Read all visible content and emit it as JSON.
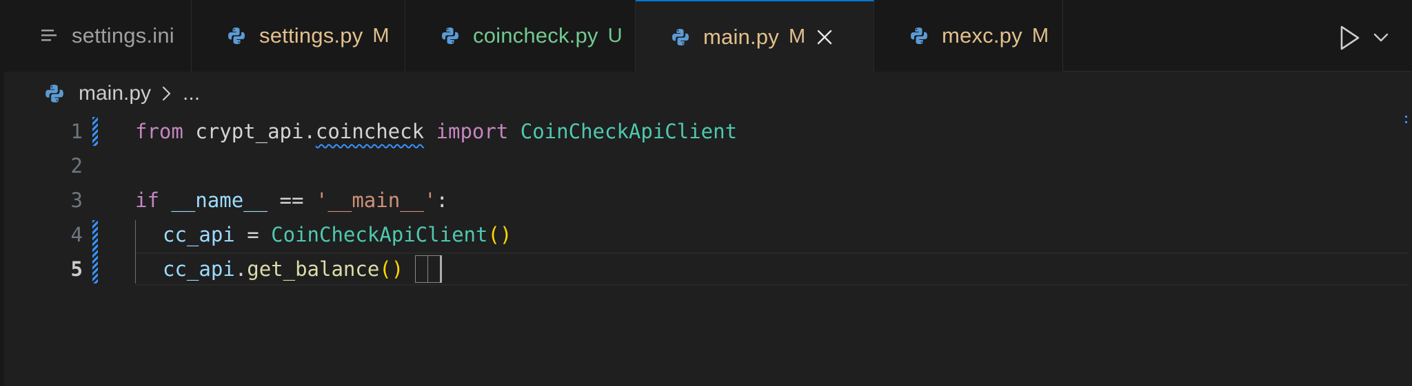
{
  "tabs": [
    {
      "label": "settings.ini",
      "badge": "",
      "icon": "list-icon",
      "color": "#a0a0a0",
      "active": false
    },
    {
      "label": "settings.py",
      "badge": "M",
      "icon": "python-icon",
      "color": "#e2c08d",
      "active": false
    },
    {
      "label": "coincheck.py",
      "badge": "U",
      "icon": "python-icon",
      "color": "#73c991",
      "active": false
    },
    {
      "label": "main.py",
      "badge": "M",
      "icon": "python-icon",
      "color": "#e2c08d",
      "active": true
    },
    {
      "label": "mexc.py",
      "badge": "M",
      "icon": "python-icon",
      "color": "#e2c08d",
      "active": false
    }
  ],
  "toolbar": {
    "run_icon": "play-icon",
    "dropdown_icon": "chevron-down-icon"
  },
  "breadcrumb": {
    "file": "main.py",
    "more": "..."
  },
  "editor": {
    "line_numbers": [
      "1",
      "2",
      "3",
      "4",
      "5"
    ],
    "current_line": "5",
    "lines": {
      "l1": {
        "kw_from": "from",
        "module_a": "crypt_api",
        "dot": ".",
        "module_b": "coincheck",
        "kw_import": "import",
        "cls": "CoinCheckApiClient"
      },
      "l3": {
        "kw_if": "if",
        "name": "__name__",
        "op": "==",
        "str": "'__main__'",
        "colon": ":"
      },
      "l4": {
        "var": "cc_api",
        "op": "=",
        "cls": "CoinCheckApiClient",
        "paren": "()"
      },
      "l5": {
        "var": "cc_api",
        "dot": ".",
        "fn": "get_balance",
        "paren_open": "(",
        "paren_close": ")"
      }
    }
  },
  "colors": {
    "accent": "#0078d4",
    "modified": "#e2c08d",
    "untracked": "#73c991",
    "keyword": "#c586c0",
    "class": "#4ec9b0",
    "function": "#dcdcaa",
    "string": "#ce9178",
    "variable": "#9cdcfe"
  }
}
